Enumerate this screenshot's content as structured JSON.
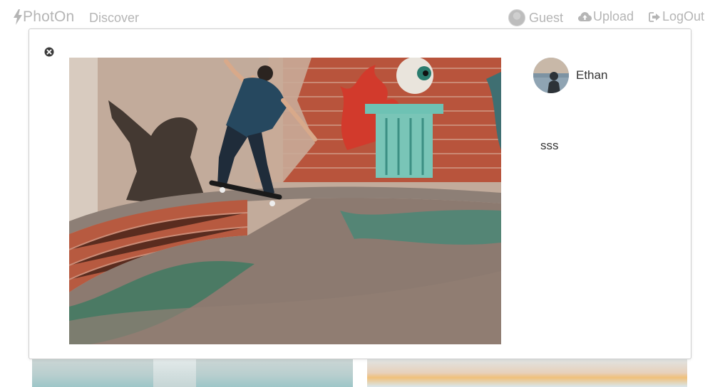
{
  "brand": {
    "name": "PhotOn",
    "icon": "bolt-icon"
  },
  "nav": {
    "discover": "Discover",
    "guest": "Guest",
    "upload": "Upload",
    "logout": "LogOut",
    "icons": {
      "guest": "avatar-icon",
      "upload": "cloud-upload-icon",
      "logout": "sign-out-icon"
    }
  },
  "modal": {
    "close_icon": "close-circle-icon",
    "photo_description": "skateboarder-grinding-pool-wall",
    "author": {
      "name": "Ethan"
    },
    "caption": "sss"
  },
  "colors": {
    "nav_text": "#b5b5b5",
    "body_text": "#333333",
    "modal_border": "#cfcfcf"
  }
}
